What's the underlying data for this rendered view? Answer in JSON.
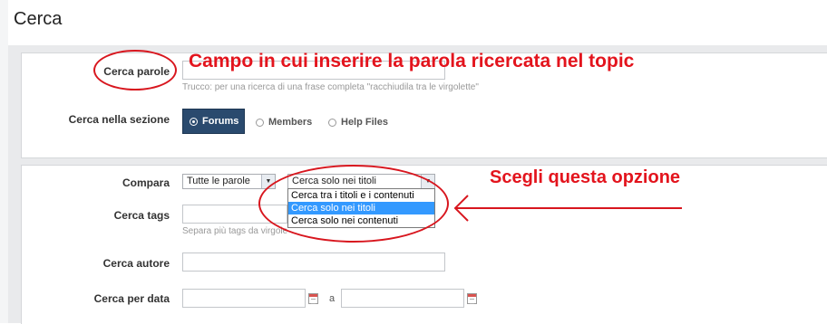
{
  "page": {
    "title": "Cerca"
  },
  "search_words": {
    "label": "Cerca parole",
    "value": "",
    "hint": "Trucco: per una ricerca di una frase completa \"racchiudila tra le virgolette\""
  },
  "section": {
    "label": "Cerca nella sezione",
    "options": [
      {
        "label": "Forums",
        "selected": true
      },
      {
        "label": "Members",
        "selected": false
      },
      {
        "label": "Help Files",
        "selected": false
      }
    ]
  },
  "compare": {
    "label": "Compara",
    "match_select": "Tutte le parole",
    "scope_select": "Cerca solo nei titoli",
    "dropdown_options": [
      {
        "label": "Cerca tra i titoli e i contenuti",
        "highlighted": false
      },
      {
        "label": "Cerca solo nei titoli",
        "highlighted": true
      },
      {
        "label": "Cerca solo nei contenuti",
        "highlighted": false
      }
    ]
  },
  "tags": {
    "label": "Cerca tags",
    "value": "",
    "hint": "Separa più tags da virgole"
  },
  "author": {
    "label": "Cerca autore",
    "value": ""
  },
  "date": {
    "label": "Cerca per data",
    "from": "",
    "separator": "a",
    "to": ""
  },
  "annotations": {
    "field_note": "Campo in cui inserire la parola ricercata nel topic",
    "option_note": "Scegli questa opzione",
    "color": "#e3141d"
  },
  "colors": {
    "tab_active": "#2a4a6e",
    "highlight": "#3399ff"
  }
}
